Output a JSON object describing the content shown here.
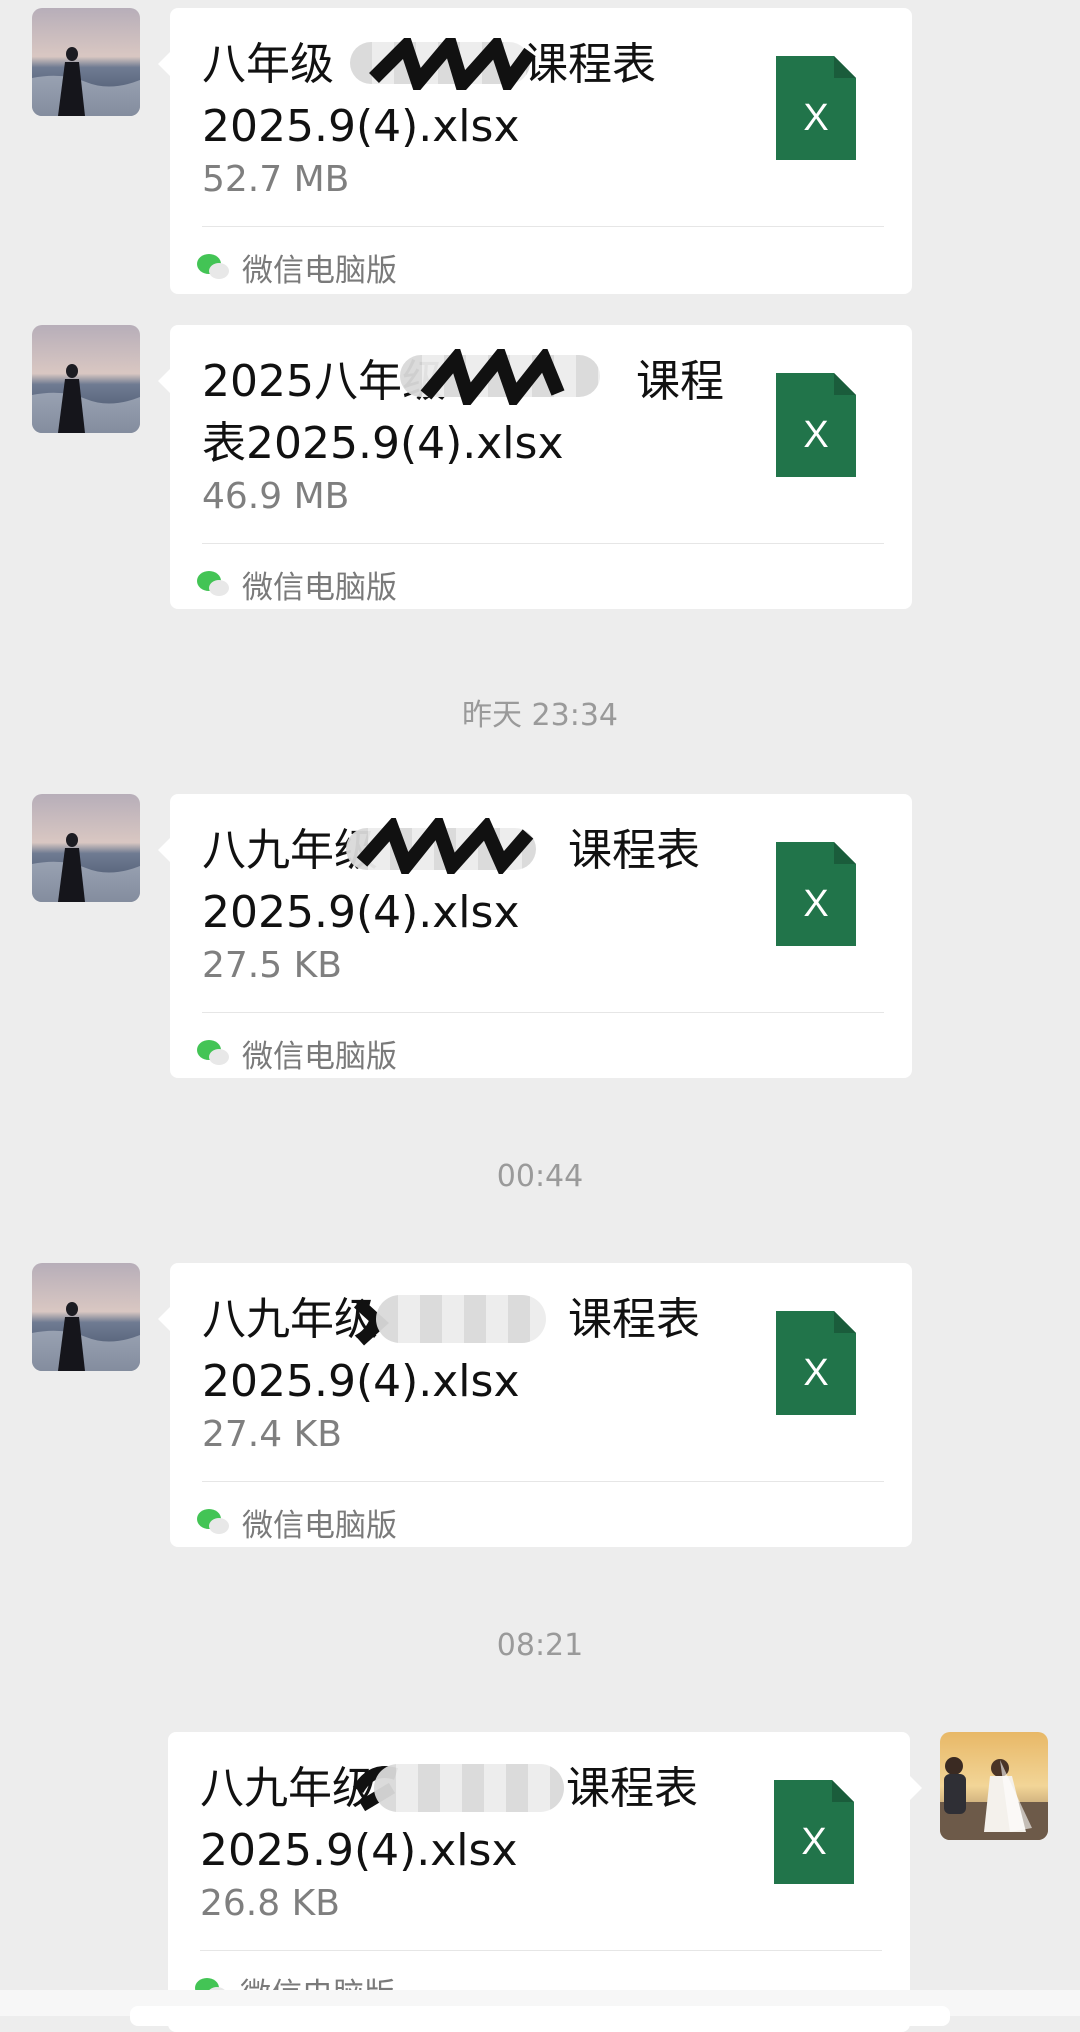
{
  "messages": [
    {
      "name": "八年级",
      "rest": "课程表\n2025.9(4).xlsx",
      "size": "52.7 MB",
      "source": "微信电脑版"
    },
    {
      "name": "2025八年级",
      "rest": "课程\n表2025.9(4).xlsx",
      "size": "46.9 MB",
      "source": "微信电脑版"
    },
    {
      "name": "八九年级",
      "rest": "课程表\n2025.9(4).xlsx",
      "size": "27.5 KB",
      "source": "微信电脑版"
    },
    {
      "name": "八九年级",
      "rest": "课程表\n2025.9(4).xlsx",
      "size": "27.4 KB",
      "source": "微信电脑版"
    },
    {
      "name": "八九年级",
      "rest": "课程表\n2025.9(4).xlsx",
      "size": "26.8 KB",
      "source": "微信电脑版"
    }
  ],
  "timestamps": [
    "昨天 23:34",
    "00:44",
    "08:21"
  ],
  "icons": {
    "file": "excel-file-icon",
    "source": "wechat-icon"
  },
  "colors": {
    "excel_green": "#21744a",
    "background": "#ededed",
    "wechat_green": "#43c455"
  }
}
